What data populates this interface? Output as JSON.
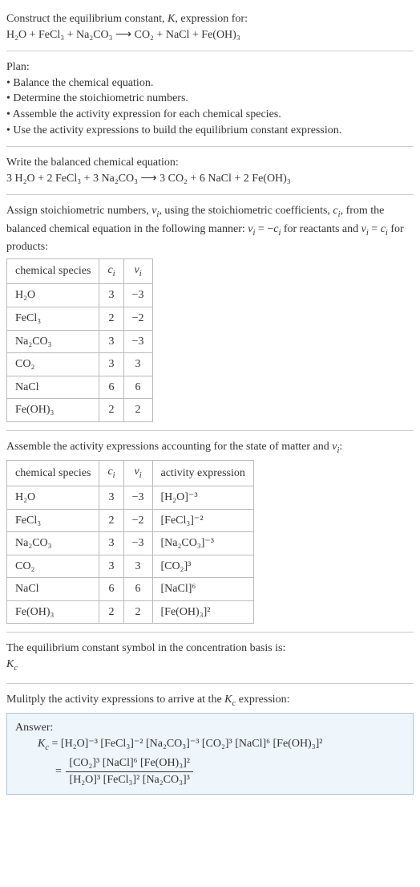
{
  "header": {
    "line1": "Construct the equilibrium constant, ",
    "K": "K",
    "line1b": ", expression for:",
    "eq": "H₂O + FeCl₃ + Na₂CO₃  ⟶  CO₂ + NaCl + Fe(OH)₃"
  },
  "plan": {
    "title": "Plan:",
    "items": [
      "Balance the chemical equation.",
      "Determine the stoichiometric numbers.",
      "Assemble the activity expression for each chemical species.",
      "Use the activity expressions to build the equilibrium constant expression."
    ]
  },
  "balanced": {
    "title": "Write the balanced chemical equation:",
    "eq": "3 H₂O + 2 FeCl₃ + 3 Na₂CO₃  ⟶  3 CO₂ + 6 NaCl + 2 Fe(OH)₃"
  },
  "assign": {
    "line1": "Assign stoichiometric numbers, ",
    "nu": "ν",
    "line1b": ", using the stoichiometric coefficients, ",
    "ci": "c",
    "line1c": ", from the balanced chemical equation in the following manner: ",
    "rel1a": "ν",
    "rel1b": " = −",
    "rel1c": "c",
    "rel1d": " for reactants and ",
    "rel2a": "ν",
    "rel2b": " = ",
    "rel2c": "c",
    "rel2d": " for products:"
  },
  "table1": {
    "headers": [
      "chemical species",
      "cᵢ",
      "νᵢ"
    ],
    "rows": [
      {
        "sp": "H₂O",
        "c": "3",
        "v": "−3"
      },
      {
        "sp": "FeCl₃",
        "c": "2",
        "v": "−2"
      },
      {
        "sp": "Na₂CO₃",
        "c": "3",
        "v": "−3"
      },
      {
        "sp": "CO₂",
        "c": "3",
        "v": "3"
      },
      {
        "sp": "NaCl",
        "c": "6",
        "v": "6"
      },
      {
        "sp": "Fe(OH)₃",
        "c": "2",
        "v": "2"
      }
    ]
  },
  "assemble": {
    "line": "Assemble the activity expressions accounting for the state of matter and ",
    "nu": "ν",
    "colon": ":"
  },
  "table2": {
    "headers": [
      "chemical species",
      "cᵢ",
      "νᵢ",
      "activity expression"
    ],
    "rows": [
      {
        "sp": "H₂O",
        "c": "3",
        "v": "−3",
        "a": "[H₂O]⁻³"
      },
      {
        "sp": "FeCl₃",
        "c": "2",
        "v": "−2",
        "a": "[FeCl₃]⁻²"
      },
      {
        "sp": "Na₂CO₃",
        "c": "3",
        "v": "−3",
        "a": "[Na₂CO₃]⁻³"
      },
      {
        "sp": "CO₂",
        "c": "3",
        "v": "3",
        "a": "[CO₂]³"
      },
      {
        "sp": "NaCl",
        "c": "6",
        "v": "6",
        "a": "[NaCl]⁶"
      },
      {
        "sp": "Fe(OH)₃",
        "c": "2",
        "v": "2",
        "a": "[Fe(OH)₃]²"
      }
    ]
  },
  "symbol": {
    "line": "The equilibrium constant symbol in the concentration basis is:",
    "Kc": "K",
    "c": "c"
  },
  "multiply": {
    "line": "Mulitply the activity expressions to arrive at the ",
    "Kc": "K",
    "c": "c",
    "after": " expression:"
  },
  "answer": {
    "label": "Answer:",
    "lhs": "K",
    "c": "c",
    "eq": " = ",
    "prod": "[H₂O]⁻³ [FeCl₃]⁻² [Na₂CO₃]⁻³ [CO₂]³ [NaCl]⁶ [Fe(OH)₃]²",
    "eq2": "= ",
    "num": "[CO₂]³ [NaCl]⁶ [Fe(OH)₃]²",
    "den": "[H₂O]³ [FeCl₃]² [Na₂CO₃]³"
  },
  "chart_data": {
    "type": "table",
    "tables": [
      {
        "title": "Stoichiometric numbers",
        "columns": [
          "chemical species",
          "c_i",
          "ν_i"
        ],
        "rows": [
          [
            "H2O",
            3,
            -3
          ],
          [
            "FeCl3",
            2,
            -2
          ],
          [
            "Na2CO3",
            3,
            -3
          ],
          [
            "CO2",
            3,
            3
          ],
          [
            "NaCl",
            6,
            6
          ],
          [
            "Fe(OH)3",
            2,
            2
          ]
        ]
      },
      {
        "title": "Activity expressions",
        "columns": [
          "chemical species",
          "c_i",
          "ν_i",
          "activity expression"
        ],
        "rows": [
          [
            "H2O",
            3,
            -3,
            "[H2O]^-3"
          ],
          [
            "FeCl3",
            2,
            -2,
            "[FeCl3]^-2"
          ],
          [
            "Na2CO3",
            3,
            -3,
            "[Na2CO3]^-3"
          ],
          [
            "CO2",
            3,
            3,
            "[CO2]^3"
          ],
          [
            "NaCl",
            6,
            6,
            "[NaCl]^6"
          ],
          [
            "Fe(OH)3",
            2,
            2,
            "[Fe(OH)3]^2"
          ]
        ]
      }
    ]
  }
}
